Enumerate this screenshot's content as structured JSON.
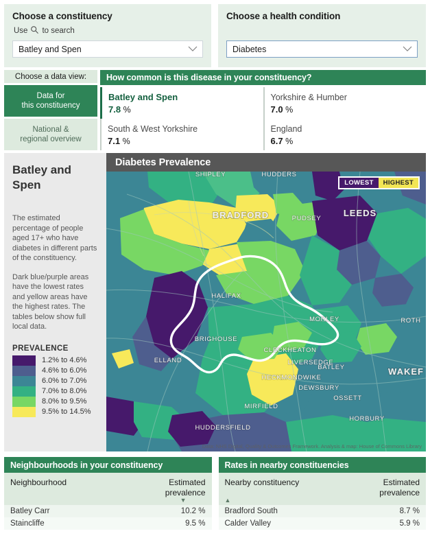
{
  "selectors": {
    "constituency": {
      "title": "Choose a constituency",
      "hint_prefix": "Use",
      "hint_suffix": "to search",
      "hint_icon": "search-icon",
      "value": "Batley and Spen"
    },
    "condition": {
      "title": "Choose a health condition",
      "value": "Diabetes"
    }
  },
  "dataview": {
    "label": "Choose a data view:",
    "tabs": [
      {
        "line1": "Data for",
        "line2": "this constituency",
        "active": true
      },
      {
        "line1": "National &",
        "line2": "regional overview",
        "active": false
      }
    ]
  },
  "summary": {
    "banner": "How common is this disease in your constituency?",
    "stats": [
      {
        "label": "Batley and Spen",
        "value": "7.8",
        "unit": "%",
        "primary": true
      },
      {
        "label": "Yorkshire & Humber",
        "value": "7.0",
        "unit": "%",
        "primary": false
      },
      {
        "label": "South & West Yorkshire",
        "value": "7.1",
        "unit": "%",
        "primary": false
      },
      {
        "label": "England",
        "value": "6.7",
        "unit": "%",
        "primary": false
      }
    ]
  },
  "map_panel": {
    "side_title": "Batley and Spen",
    "paragraph1": "The estimated percentage of people aged 17+ who have diabetes in different parts of the constituency.",
    "paragraph2": "Dark blue/purple areas have the lowest rates and yellow areas have the highest rates. The tables below show full local data.",
    "legend_title": "PREVALENCE",
    "legend": [
      {
        "label": "1.2% to 4.6%",
        "color": "#46196b"
      },
      {
        "label": "4.6% to 6.0%",
        "color": "#4e5e8e"
      },
      {
        "label": "6.0% to 7.0%",
        "color": "#3c8695"
      },
      {
        "label": "7.0% to 8.0%",
        "color": "#33b183"
      },
      {
        "label": "8.0% to 9.5%",
        "color": "#78d764"
      },
      {
        "label": "9.5% to 14.5%",
        "color": "#f7e95a"
      }
    ],
    "map_title": "Diabetes Prevalence",
    "scale_low": "LOWEST",
    "scale_high": "HIGHEST",
    "attribution": "Data: NHS Digital, Quality & Outcomes Framework. Analysis & map: House of Commons Library",
    "place_labels": [
      "SHIPLEY",
      "BRADFORD",
      "PUDSEY",
      "LEEDS",
      "MORLEY",
      "ROTH",
      "HALIFAX",
      "CLECKHEATON",
      "BATLEY",
      "LIVERSEDGE",
      "BRIGHOUSE",
      "HECKMONDWIKE",
      "DEWSBURY",
      "OSSETT",
      "WAKEF",
      "ELLAND",
      "MIRFIELD",
      "HORBURY",
      "HUDDERSFIELD"
    ]
  },
  "tables": [
    {
      "title": "Neighbourhoods in your constituency",
      "col_name": "Neighbourhood",
      "col_value_line1": "Estimated",
      "col_value_line2": "prevalence",
      "sort_direction": "desc",
      "rows": [
        {
          "name": "Batley Carr",
          "value": "10.2 %"
        },
        {
          "name": "Staincliffe",
          "value": "9.5 %"
        }
      ]
    },
    {
      "title": "Rates in nearby constituencies",
      "col_name": "Nearby constituency",
      "col_value_line1": "Estimated",
      "col_value_line2": "prevalence",
      "sort_direction": "asc",
      "rows": [
        {
          "name": "Bradford South",
          "value": "8.7 %"
        },
        {
          "name": "Calder Valley",
          "value": "5.9 %"
        }
      ]
    }
  ],
  "chart_data": {
    "type": "heatmap",
    "title": "Diabetes Prevalence",
    "subtitle": "Batley and Spen",
    "unit": "%",
    "description": "Choropleth map of estimated diabetes prevalence among people aged 17+ by small area around Batley and Spen constituency, West Yorkshire.",
    "legend_position": "left-sidebar",
    "color_scale": "viridis",
    "bins": [
      {
        "label": "1.2% to 4.6%",
        "min": 1.2,
        "max": 4.6,
        "color": "#46196b"
      },
      {
        "label": "4.6% to 6.0%",
        "min": 4.6,
        "max": 6.0,
        "color": "#4e5e8e"
      },
      {
        "label": "6.0% to 7.0%",
        "min": 6.0,
        "max": 7.0,
        "color": "#3c8695"
      },
      {
        "label": "7.0% to 8.0%",
        "min": 7.0,
        "max": 8.0,
        "color": "#33b183"
      },
      {
        "label": "8.0% to 9.5%",
        "min": 8.0,
        "max": 9.5,
        "color": "#78d764"
      },
      {
        "label": "9.5% to 14.5%",
        "min": 9.5,
        "max": 14.5,
        "color": "#f7e95a"
      }
    ],
    "headline_values": [
      {
        "name": "Batley and Spen",
        "value": 7.8
      },
      {
        "name": "Yorkshire & Humber",
        "value": 7.0
      },
      {
        "name": "South & West Yorkshire",
        "value": 7.1
      },
      {
        "name": "England",
        "value": 6.7
      }
    ],
    "neighbourhoods": [
      {
        "name": "Batley Carr",
        "value": 10.2
      },
      {
        "name": "Staincliffe",
        "value": 9.5
      }
    ],
    "nearby_constituencies": [
      {
        "name": "Bradford South",
        "value": 8.7
      },
      {
        "name": "Calder Valley",
        "value": 5.9
      }
    ]
  }
}
